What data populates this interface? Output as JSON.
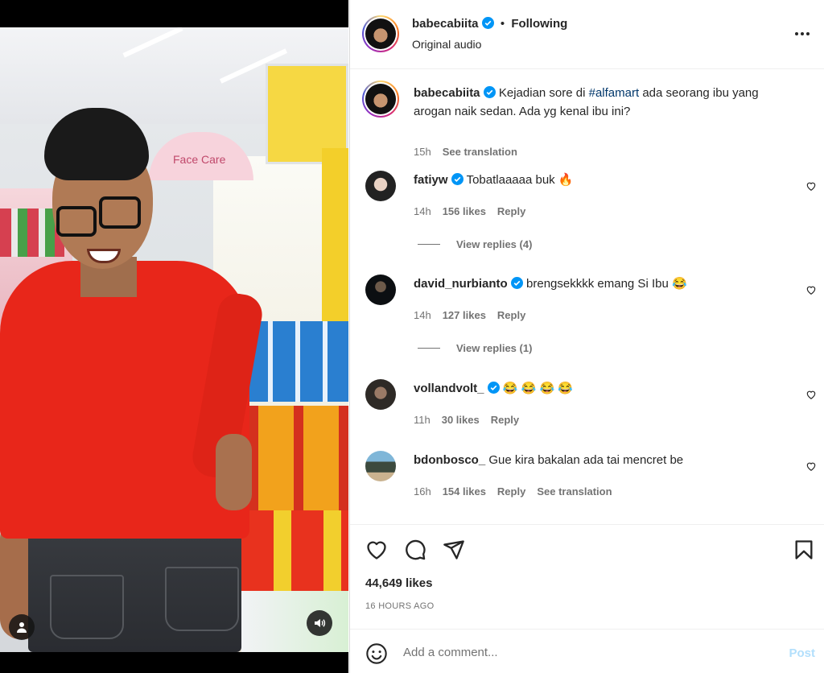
{
  "post": {
    "author": "babecabiita",
    "audio": "Original audio",
    "follow_state": "Following",
    "caption_prefix": "Kejadian sore di ",
    "caption_hashtag": "#alfamart",
    "caption_suffix": " ada seorang ibu yang arogan naik sedan. Ada yg kenal ibu ini?",
    "caption_time": "15h",
    "see_translation": "See translation",
    "likes": "44,649 likes",
    "time_ago": "16 HOURS AGO"
  },
  "media": {
    "store_sign": "Face Care",
    "user_tag_icon": "user-tag-icon",
    "sound_icon": "sound-on-icon"
  },
  "comments": [
    {
      "user": "fatiyw",
      "verified": true,
      "text": "Tobatlaaaaa buk 🔥",
      "time": "14h",
      "likes": "156 likes",
      "reply": "Reply",
      "view_replies": "View replies (4)"
    },
    {
      "user": "david_nurbianto",
      "verified": true,
      "text": "brengsekkkk emang Si Ibu 😂",
      "time": "14h",
      "likes": "127 likes",
      "reply": "Reply",
      "view_replies": "View replies (1)"
    },
    {
      "user": "vollandvolt_",
      "verified": true,
      "text": "😂 😂 😂 😂",
      "time": "11h",
      "likes": "30 likes",
      "reply": "Reply"
    },
    {
      "user": "bdonbosco_",
      "verified": false,
      "text": "Gue kira bakalan ada tai mencret be",
      "time": "16h",
      "likes": "154 likes",
      "reply": "Reply",
      "see_translation": "See translation"
    }
  ],
  "composer": {
    "placeholder": "Add a comment...",
    "post_label": "Post"
  },
  "colors": {
    "verified_blue": "#0095f6",
    "post_disabled": "#b2dffc",
    "muted_text": "#737373"
  }
}
